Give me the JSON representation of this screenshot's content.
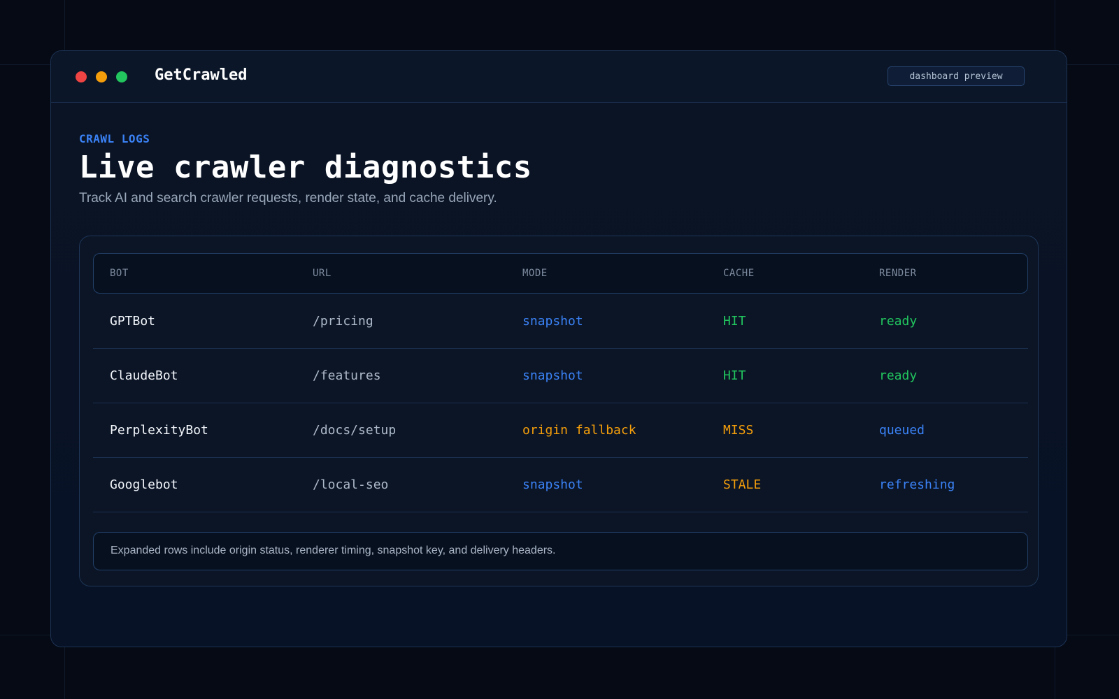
{
  "window": {
    "brand": "GetCrawled",
    "badge": "dashboard preview"
  },
  "header": {
    "eyebrow": "CRAWL LOGS",
    "title": "Live crawler diagnostics",
    "subtitle": "Track AI and search crawler requests, render state, and cache delivery."
  },
  "table": {
    "columns": [
      "BOT",
      "URL",
      "MODE",
      "CACHE",
      "RENDER"
    ],
    "rows": [
      {
        "bot": "GPTBot",
        "url": "/pricing",
        "mode": "snapshot",
        "cache": "HIT",
        "render": "ready"
      },
      {
        "bot": "ClaudeBot",
        "url": "/features",
        "mode": "snapshot",
        "cache": "HIT",
        "render": "ready"
      },
      {
        "bot": "PerplexityBot",
        "url": "/docs/setup",
        "mode": "origin fallback",
        "cache": "MISS",
        "render": "queued"
      },
      {
        "bot": "Googlebot",
        "url": "/local-seo",
        "mode": "snapshot",
        "cache": "STALE",
        "render": "refreshing"
      }
    ],
    "footnote": "Expanded rows include origin status, renderer timing, snapshot key, and delivery headers."
  },
  "colors": {
    "accent_blue": "#3b82f6",
    "status_green": "#22c55e",
    "status_orange": "#f59e0b",
    "dot_red": "#ef4444"
  }
}
